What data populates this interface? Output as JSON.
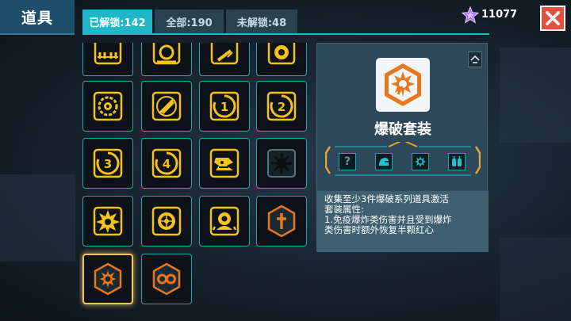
{
  "header": {
    "title": "道具",
    "tabs": [
      {
        "label": "已解锁:142",
        "active": true
      },
      {
        "label": "全部:190",
        "active": false
      },
      {
        "label": "未解锁:48",
        "active": false
      }
    ],
    "currency_value": "11077",
    "close_icon": "close-icon"
  },
  "grid": {
    "items": [
      {
        "icon": "partial-item-icon",
        "state": "unlocked"
      },
      {
        "icon": "partial-item-icon",
        "state": "unlocked"
      },
      {
        "icon": "partial-item-icon",
        "state": "unlocked"
      },
      {
        "icon": "partial-item-icon",
        "state": "unlocked"
      },
      {
        "icon": "gear-ring-icon",
        "state": "unlocked"
      },
      {
        "icon": "blade-icon",
        "state": "unlocked"
      },
      {
        "icon": "number-circle-icon",
        "number": "1",
        "state": "unlocked"
      },
      {
        "icon": "number-circle-icon",
        "number": "2",
        "state": "unlocked"
      },
      {
        "icon": "number-circle-icon",
        "number": "3",
        "state": "unlocked"
      },
      {
        "icon": "number-circle-icon",
        "number": "4",
        "state": "unlocked"
      },
      {
        "icon": "monster-rune-icon",
        "state": "unlocked"
      },
      {
        "icon": "dark-burst-icon",
        "state": "unlocked"
      },
      {
        "icon": "explosion-splash-icon",
        "state": "unlocked"
      },
      {
        "icon": "flower-orb-icon",
        "state": "unlocked"
      },
      {
        "icon": "robot-bomb-icon",
        "state": "unlocked"
      },
      {
        "icon": "orange-hex-cross-icon",
        "state": "unlocked"
      },
      {
        "icon": "orange-hex-explosion-icon",
        "state": "selected"
      },
      {
        "icon": "orange-hex-infinity-icon",
        "state": "unlocked"
      }
    ]
  },
  "detail": {
    "icon": "explosion-set-icon",
    "name": "爆破套装",
    "set_items": [
      {
        "icon": "question-mark-icon",
        "label": "?"
      },
      {
        "icon": "helmet-icon"
      },
      {
        "icon": "explosion-gear-icon"
      },
      {
        "icon": "twin-bombs-icon"
      }
    ],
    "description_lines": [
      "收集至少3件爆破系列道具激活",
      "套装属性:",
      "1.免疫爆炸类伤害并且受到爆炸",
      "类伤害时额外恢复半颗红心"
    ]
  },
  "colors": {
    "accent": "#1fb7c8",
    "item_yellow": "#f4c21b",
    "set_orange": "#e8771e",
    "close_red": "#e2513e",
    "panel": "#2d4858"
  }
}
